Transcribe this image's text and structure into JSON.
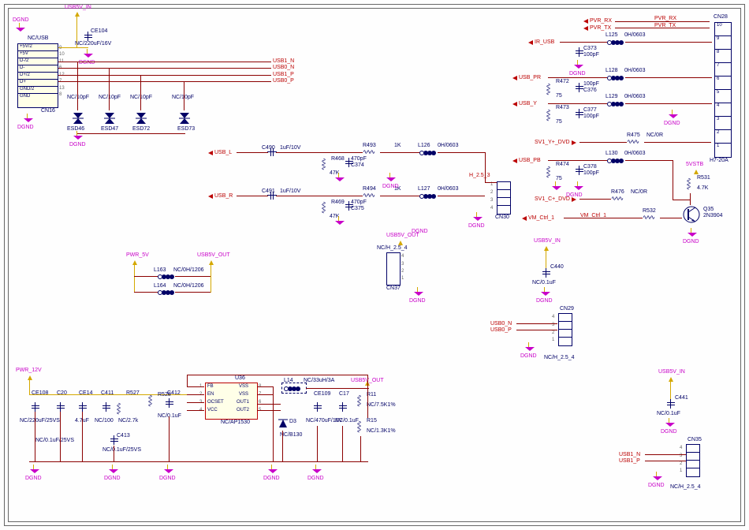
{
  "nets": {
    "dgnd": "DGND",
    "usb5v_in": "USB5V_IN",
    "usb5v_out": "USB5V_OUT",
    "pwr_5v": "PWR_5V",
    "pwr_12v": "PWR_12V",
    "pvr_rx": "PVR_RX",
    "pvr_tx": "PVR_TX",
    "ir_usb": "IR_USB",
    "usb_pr": "USB_PR",
    "usb_y": "USB_Y",
    "usb_pb": "USB_PB",
    "usb_l": "USB_L",
    "usb_r": "USB_R",
    "usb0_n": "USB0_N",
    "usb0_p": "USB0_P",
    "usb1_n": "USB1_N",
    "usb1_p": "USB1_P",
    "sv1_y_dvd": "SV1_Y+_DVD",
    "sv1_c_dvd": "SV1_C+_DVD",
    "vm_ctrl_1": "VM_Ctrl_1",
    "h_2_5_3": "H_2.5_3",
    "stb5v": "5VSTB"
  },
  "components": {
    "cn16": {
      "ref": "CN16",
      "val": "NC/USB",
      "pins": [
        "+5V/2",
        "+5V",
        "D-/2",
        "D-",
        "D+/2",
        "D+",
        "GND/2",
        "GND"
      ]
    },
    "cn28": {
      "ref": "CN28",
      "val": "H7-20A"
    },
    "cn29": {
      "ref": "CN29",
      "val": "NC/H_2.5_4"
    },
    "cn30": {
      "ref": "CN30",
      "val": ""
    },
    "cn35": {
      "ref": "CN35",
      "val": "NC/H_2.5_4"
    },
    "cn37": {
      "ref": "CN37",
      "val": "NC/H_2.5_4"
    },
    "ce104": {
      "ref": "CE104",
      "val": "NC/220uF/16V"
    },
    "ce108": {
      "ref": "CE108",
      "val": "NC/220uF/25VS"
    },
    "ce109": {
      "ref": "CE109",
      "val": "NC/470uF/10V"
    },
    "ce14": {
      "ref": "CE14",
      "val": "4.7uF"
    },
    "c20": {
      "ref": "C20",
      "val": "NC/0.1uF/25VS"
    },
    "c17": {
      "ref": "C17",
      "val": "NC/0.1uF"
    },
    "c373": {
      "ref": "C373",
      "val": "100pF"
    },
    "c374": {
      "ref": "C374",
      "val": "470pF"
    },
    "c375": {
      "ref": "C375",
      "val": "470pF"
    },
    "c376": {
      "ref": "C376",
      "val": "100pF"
    },
    "c377": {
      "ref": "C377",
      "val": "100pF"
    },
    "c378": {
      "ref": "C378",
      "val": "100pF"
    },
    "c411": {
      "ref": "C411",
      "val": "NC/100pF"
    },
    "c412": {
      "ref": "C412",
      "val": "NC/0.1uF"
    },
    "c413": {
      "ref": "C413",
      "val": "NC/0.1uF/25VS"
    },
    "c440": {
      "ref": "C440",
      "val": "NC/0.1uF"
    },
    "c441": {
      "ref": "C441",
      "val": "NC/0.1uF"
    },
    "c490": {
      "ref": "C490",
      "val": "1uF/10V"
    },
    "c491": {
      "ref": "C491",
      "val": "1uF/10V"
    },
    "l14": {
      "ref": "L14",
      "val": "NC/33uH/3A"
    },
    "l125": {
      "ref": "L125",
      "val": "0H/0603"
    },
    "l126": {
      "ref": "L126",
      "val": "0H/0603"
    },
    "l127": {
      "ref": "L127",
      "val": "0H/0603"
    },
    "l128": {
      "ref": "L128",
      "val": "0H/0603"
    },
    "l129": {
      "ref": "L129",
      "val": "0H/0603"
    },
    "l130": {
      "ref": "L130",
      "val": "0H/0603"
    },
    "l163": {
      "ref": "L163",
      "val": "NC/0H/1206"
    },
    "l164": {
      "ref": "L164",
      "val": "NC/0H/1206"
    },
    "r11": {
      "ref": "R11",
      "val": "NC/7.5K1%"
    },
    "r15": {
      "ref": "R15",
      "val": "NC/1.3K1%"
    },
    "r468": {
      "ref": "R468",
      "val": "47K"
    },
    "r469": {
      "ref": "R469",
      "val": "47K"
    },
    "r472": {
      "ref": "R472",
      "val": "75"
    },
    "r473": {
      "ref": "R473",
      "val": "75"
    },
    "r474": {
      "ref": "R474",
      "val": "75"
    },
    "r475": {
      "ref": "R475",
      "val": "NC/0R"
    },
    "r476": {
      "ref": "R476",
      "val": "NC/0R"
    },
    "r493": {
      "ref": "R493",
      "val": "1K"
    },
    "r494": {
      "ref": "R494",
      "val": "1K"
    },
    "r527": {
      "ref": "R527",
      "val": "NC/2.7k"
    },
    "r528": {
      "ref": "R528",
      "val": ""
    },
    "r531": {
      "ref": "R531",
      "val": "4.7K"
    },
    "r532": {
      "ref": "R532",
      "val": ""
    },
    "q35": {
      "ref": "Q35",
      "val": "2N3904"
    },
    "d3": {
      "ref": "D3",
      "val": "NC/B130"
    },
    "u36": {
      "ref": "U36",
      "val": "NC/AP1530",
      "pins_left": [
        "FB",
        "EN",
        "OCSET",
        "VCC"
      ],
      "pins_right": [
        "VSS",
        "VSS",
        "OUT1",
        "OUT2"
      ]
    },
    "esd46": {
      "ref": "ESD46",
      "val": "NC/10pF"
    },
    "esd47": {
      "ref": "ESD47",
      "val": "NC/10pF"
    },
    "esd72": {
      "ref": "ESD72",
      "val": "NC/10pF"
    },
    "esd73": {
      "ref": "ESD73",
      "val": "NC/10pF"
    }
  }
}
